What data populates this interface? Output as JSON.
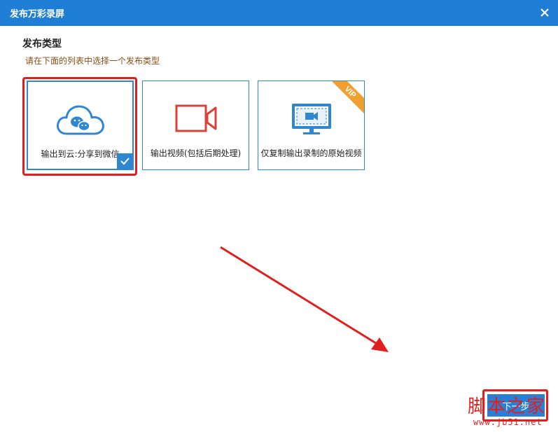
{
  "dialog": {
    "title": "发布万彩录屏",
    "close_icon": "close-icon"
  },
  "section": {
    "title": "发布类型",
    "hint": "请在下面的列表中选择一个发布类型"
  },
  "options": [
    {
      "label": "输出到云:分享到微信",
      "icon": "cloud-wechat-icon",
      "selected": true
    },
    {
      "label": "输出视频(包括后期处理)",
      "icon": "video-camera-icon",
      "selected": false
    },
    {
      "label": "仅复制输出录制的原始视频",
      "icon": "monitor-video-icon",
      "selected": false,
      "badge": "VIP"
    }
  ],
  "footer": {
    "next_label": "下一步"
  },
  "watermark": {
    "chars": "脚本之家",
    "url": "www.jb51.net"
  },
  "colors": {
    "title_bar": "#1e7ed6",
    "accent": "#2f87d1",
    "highlight": "#e01f1f",
    "hint_text": "#8a4d14",
    "vip": "#f0a030",
    "video_icon": "#d9423a"
  }
}
